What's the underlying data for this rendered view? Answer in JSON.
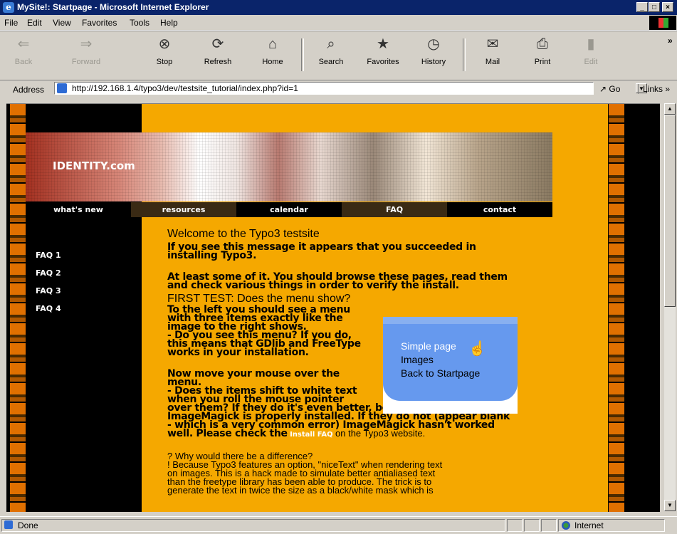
{
  "window": {
    "title": "MySite!: Startpage - Microsoft Internet Explorer",
    "ie_glyph": "e",
    "controls": [
      "_",
      "□",
      "×"
    ]
  },
  "menubar": {
    "items": [
      "File",
      "Edit",
      "View",
      "Favorites",
      "Tools",
      "Help"
    ]
  },
  "toolbar": {
    "buttons": [
      {
        "label": "Back",
        "icon": "back-arrow-icon",
        "glyph": "⇐",
        "enabled": false
      },
      {
        "label": "Forward",
        "icon": "forward-arrow-icon",
        "glyph": "⇒",
        "enabled": false
      },
      {
        "label": "Stop",
        "icon": "stop-icon",
        "glyph": "⊗",
        "enabled": true
      },
      {
        "label": "Refresh",
        "icon": "refresh-icon",
        "glyph": "⟳",
        "enabled": true
      },
      {
        "label": "Home",
        "icon": "home-icon",
        "glyph": "⌂",
        "enabled": true
      },
      {
        "label": "Search",
        "icon": "search-icon",
        "glyph": "⌕",
        "enabled": true
      },
      {
        "label": "Favorites",
        "icon": "favorites-icon",
        "glyph": "★",
        "enabled": true
      },
      {
        "label": "History",
        "icon": "history-icon",
        "glyph": "◷",
        "enabled": true
      },
      {
        "label": "Mail",
        "icon": "mail-icon",
        "glyph": "✉",
        "enabled": true
      },
      {
        "label": "Print",
        "icon": "print-icon",
        "glyph": "⎙",
        "enabled": true
      },
      {
        "label": "Edit",
        "icon": "edit-icon",
        "glyph": "▮",
        "enabled": false
      }
    ],
    "overflow": "»"
  },
  "addressbar": {
    "label": "Address",
    "url": "http://192.168.1.4/typo3/dev/testsite_tutorial/index.php?id=1",
    "go": "Go",
    "links": "Links »"
  },
  "page": {
    "logo": "IDENTITY.com",
    "nav": [
      "what's new",
      "resources",
      "calendar",
      "FAQ",
      "contact"
    ],
    "nav_colors": [
      "#000000",
      "#3a2a14",
      "#000000",
      "#3a2a14",
      "#000000"
    ],
    "sidebar": [
      "FAQ 1",
      "FAQ 2",
      "FAQ 3",
      "FAQ 4"
    ],
    "content": {
      "welcome_heading": "Welcome to the Typo3 testsite",
      "p1a": "If you see this message it appears that you succeeded in",
      "p1b": "installing Typo3.",
      "p2a": "At least some of it. You should browse these pages, read them",
      "p2b": "and check various things in order to verify the install.",
      "first_test_heading": "FIRST TEST: Does the menu show?",
      "p3": [
        "To the left you should see a menu",
        "with three items exactly like the",
        "image to the right shows.",
        "- Do you see this menu? If you do,",
        "this means that GDlib and FreeType",
        "works in your installation."
      ],
      "p4": [
        "Now move your mouse over the",
        "menu.",
        "- Does the items shift to white text",
        "when you roll the mouse pointer"
      ],
      "p4_wide": [
        "over them? If they do it's even better, because this means that",
        "ImageMagick is properly installed. If they do not (appear blank",
        "- which is a very common error) ImageMagick hasn't worked"
      ],
      "p4_last_pre": "well. Please check the",
      "install_faq_link": "Install FAQ",
      "p4_last_post": "on the Typo3 website.",
      "p5": [
        "? Why would there be a difference?",
        "! Because Typo3 features an option, \"niceText\" when rendering text",
        "on images. This is a hack made to simulate better antialiased text",
        "than the freetype library has been able to produce. The trick is to",
        "generate the text in twice the size as a black/white mask which is"
      ]
    },
    "menu_image_items": [
      "Simple page",
      "Images",
      "Back to Startpage"
    ]
  },
  "statusbar": {
    "text": "Done",
    "zone": "Internet"
  }
}
